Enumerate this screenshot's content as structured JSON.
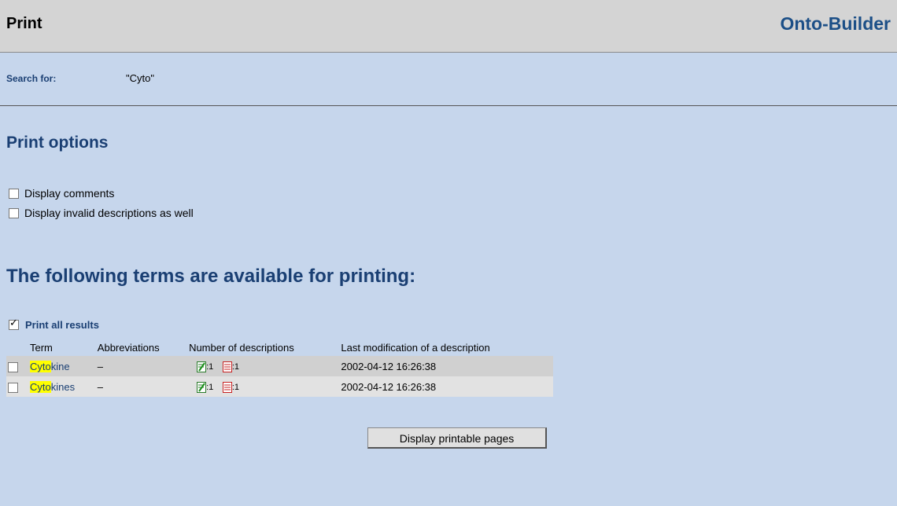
{
  "header": {
    "title": "Print",
    "brand": "Onto-Builder"
  },
  "search": {
    "label": "Search for:",
    "value": "\"Cyto\""
  },
  "options": {
    "heading": "Print options",
    "items": [
      {
        "label": "Display comments",
        "checked": false
      },
      {
        "label": "Display invalid descriptions as well",
        "checked": false
      }
    ]
  },
  "available": {
    "heading": "The following terms are available for printing:",
    "print_all_label": "Print all results",
    "print_all_checked": true
  },
  "table": {
    "columns": [
      "Term",
      "Abbreviations",
      "Number of descriptions",
      "Last modification of a description"
    ],
    "rows": [
      {
        "term_highlight": "Cyto",
        "term_rest": "kine",
        "abbreviations": "–",
        "valid_count": ":1",
        "invalid_count": ":1",
        "last_modified": "2002-04-12 16:26:38",
        "checked": false
      },
      {
        "term_highlight": "Cyto",
        "term_rest": "kines",
        "abbreviations": "–",
        "valid_count": ":1",
        "invalid_count": ":1",
        "last_modified": "2002-04-12 16:26:38",
        "checked": false
      }
    ]
  },
  "actions": {
    "display_label": "Display printable pages"
  },
  "colors": {
    "heading": "#1a3f73",
    "background": "#c6d6ec",
    "header": "#d4d4d4",
    "highlight": "#ffff00"
  },
  "icons": [
    "valid-description-icon",
    "invalid-description-icon"
  ]
}
